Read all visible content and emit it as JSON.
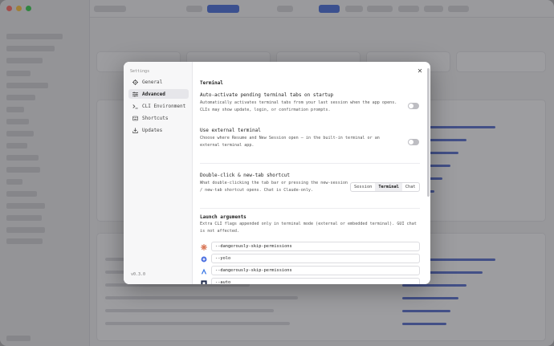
{
  "settings": {
    "title": "Settings",
    "nav": [
      {
        "label": "General",
        "icon": "gear-icon"
      },
      {
        "label": "Advanced",
        "icon": "sliders-icon"
      },
      {
        "label": "CLI Environment",
        "icon": "terminal-icon"
      },
      {
        "label": "Shortcuts",
        "icon": "grid-icon"
      },
      {
        "label": "Updates",
        "icon": "download-icon"
      }
    ],
    "active_nav": "Advanced",
    "version": "v0.3.0"
  },
  "terminal": {
    "section_title": "Terminal",
    "auto_activate": {
      "title": "Auto-activate pending terminal tabs on startup",
      "desc": "Automatically activates terminal tabs from your last session when the app opens. CLIs may show update, login, or confirmation prompts.",
      "enabled": false
    },
    "external": {
      "title": "Use external terminal",
      "desc": "Choose where Resume and New Session open — in the built-in terminal or an external terminal app.",
      "enabled": false
    },
    "double_click": {
      "title": "Double-click & new-tab shortcut",
      "desc": "What double-clicking the tab bar or pressing the new-session / new-tab shortcut opens. Chat is Claude-only.",
      "options": [
        "Session",
        "Terminal",
        "Chat"
      ],
      "selected": "Terminal"
    }
  },
  "launch": {
    "section_title": "Launch arguments",
    "desc": "Extra CLI flags appended only in terminal mode (external or embedded terminal). GUI chat is not affected.",
    "args": [
      {
        "icon": "claude-icon",
        "icon_color": "#d97757",
        "value": "--dangerously-skip-permissions"
      },
      {
        "icon": "gemini-icon",
        "icon_color": "#4a6ee0",
        "value": "--yolo"
      },
      {
        "icon": "codex-icon",
        "icon_color": "#3a78e6",
        "value": "--dangerously-skip-permissions"
      },
      {
        "icon": "cursor-icon",
        "icon_color": "#1e2a4a",
        "value": "--auto"
      }
    ]
  }
}
